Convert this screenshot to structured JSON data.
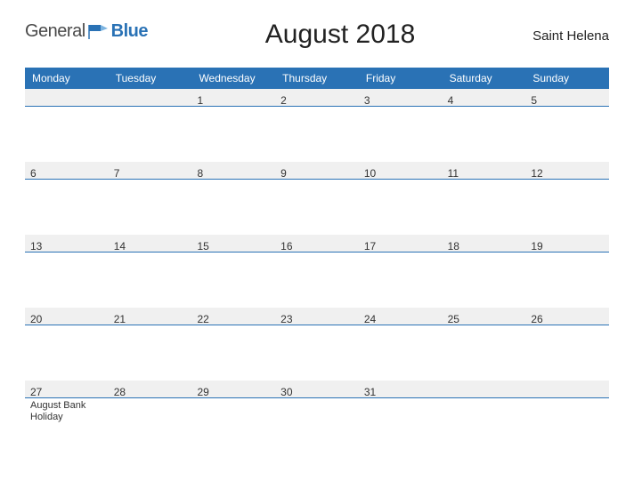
{
  "logo": {
    "word1": "General",
    "word2": "Blue"
  },
  "title": "August 2018",
  "region": "Saint Helena",
  "day_headers": [
    "Monday",
    "Tuesday",
    "Wednesday",
    "Thursday",
    "Friday",
    "Saturday",
    "Sunday"
  ],
  "weeks": [
    [
      {
        "n": ""
      },
      {
        "n": ""
      },
      {
        "n": "1"
      },
      {
        "n": "2"
      },
      {
        "n": "3"
      },
      {
        "n": "4"
      },
      {
        "n": "5"
      }
    ],
    [
      {
        "n": "6"
      },
      {
        "n": "7"
      },
      {
        "n": "8"
      },
      {
        "n": "9"
      },
      {
        "n": "10"
      },
      {
        "n": "11"
      },
      {
        "n": "12"
      }
    ],
    [
      {
        "n": "13"
      },
      {
        "n": "14"
      },
      {
        "n": "15"
      },
      {
        "n": "16"
      },
      {
        "n": "17"
      },
      {
        "n": "18"
      },
      {
        "n": "19"
      }
    ],
    [
      {
        "n": "20"
      },
      {
        "n": "21"
      },
      {
        "n": "22"
      },
      {
        "n": "23"
      },
      {
        "n": "24"
      },
      {
        "n": "25"
      },
      {
        "n": "26"
      }
    ],
    [
      {
        "n": "27",
        "event": "August Bank Holiday"
      },
      {
        "n": "28"
      },
      {
        "n": "29"
      },
      {
        "n": "30"
      },
      {
        "n": "31"
      },
      {
        "n": ""
      },
      {
        "n": ""
      }
    ]
  ]
}
